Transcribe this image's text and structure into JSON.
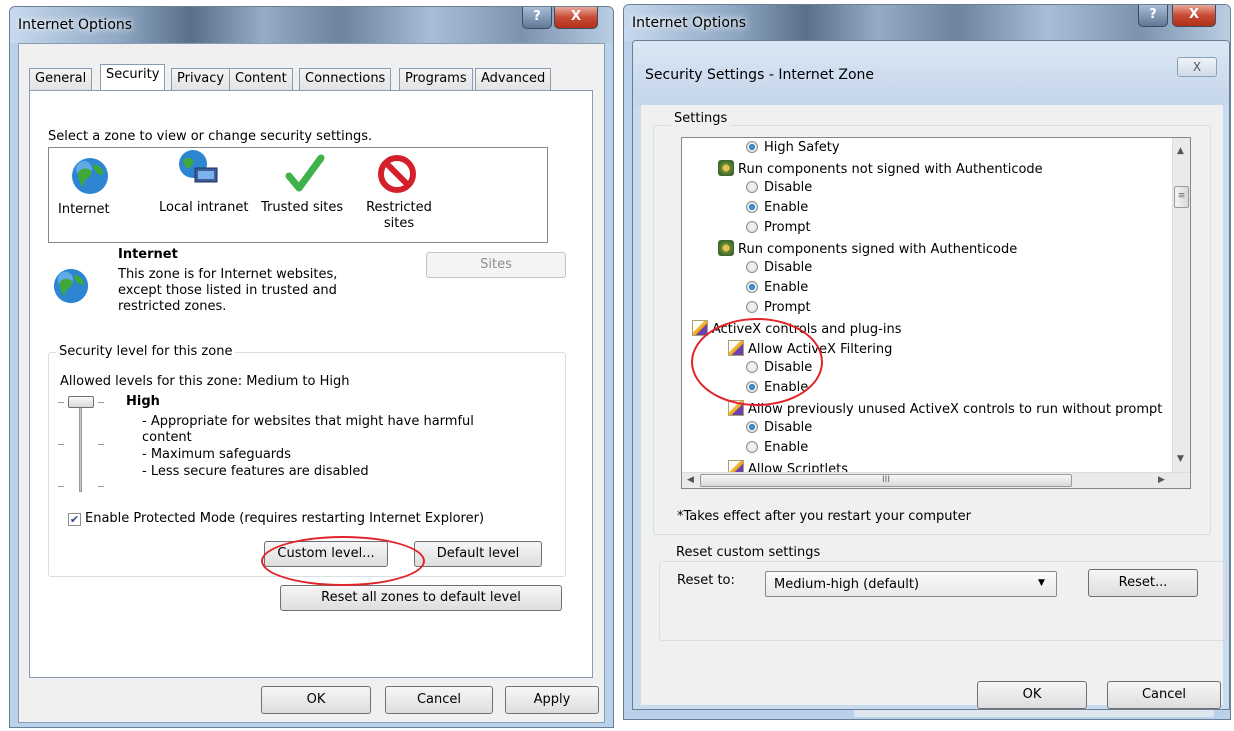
{
  "left": {
    "title": "Internet Options",
    "help": "?",
    "close": "X",
    "tabs": [
      "General",
      "Security",
      "Privacy",
      "Content",
      "Connections",
      "Programs",
      "Advanced"
    ],
    "zone_prompt": "Select a zone to view or change security settings.",
    "zones": [
      "Internet",
      "Local intranet",
      "Trusted sites",
      "Restricted sites"
    ],
    "zone_name": "Internet",
    "zone_desc": [
      "This zone is for Internet websites,",
      "except those listed in trusted and",
      "restricted zones."
    ],
    "sites": "Sites",
    "level_group": "Security level for this zone",
    "allowed": "Allowed levels for this zone: Medium to High",
    "level": "High",
    "level_lines": [
      "- Appropriate for websites that might have harmful",
      "content",
      "- Maximum safeguards",
      "- Less secure features are disabled"
    ],
    "protected": "Enable Protected Mode (requires restarting Internet Explorer)",
    "custom": "Custom level...",
    "default": "Default level",
    "reset_all": "Reset all zones to default level",
    "ok": "OK",
    "cancel": "Cancel",
    "apply": "Apply"
  },
  "right": {
    "title": "Internet Options",
    "help": "?",
    "close": "X",
    "dialog_title": "Security Settings - Internet Zone",
    "dialog_close": "X",
    "settings_label": "Settings",
    "items": [
      {
        "kind": "radio",
        "on": true,
        "text": "High Safety"
      },
      {
        "kind": "head",
        "text": "Run components not signed with Authenticode"
      },
      {
        "kind": "radio",
        "on": false,
        "text": "Disable"
      },
      {
        "kind": "radio",
        "on": true,
        "text": "Enable"
      },
      {
        "kind": "radio",
        "on": false,
        "text": "Prompt"
      },
      {
        "kind": "head",
        "text": "Run components signed with Authenticode"
      },
      {
        "kind": "radio",
        "on": false,
        "text": "Disable"
      },
      {
        "kind": "radio",
        "on": true,
        "text": "Enable"
      },
      {
        "kind": "radio",
        "on": false,
        "text": "Prompt"
      },
      {
        "kind": "category",
        "text": "ActiveX controls and plug-ins"
      },
      {
        "kind": "head2",
        "text": "Allow ActiveX Filtering"
      },
      {
        "kind": "radio",
        "on": false,
        "text": "Disable"
      },
      {
        "kind": "radio",
        "on": true,
        "text": "Enable"
      },
      {
        "kind": "head2",
        "text": "Allow previously unused ActiveX controls to run without prompt"
      },
      {
        "kind": "radio",
        "on": true,
        "text": "Disable"
      },
      {
        "kind": "radio",
        "on": false,
        "text": "Enable"
      },
      {
        "kind": "head2",
        "text": "Allow Scriptlets"
      }
    ],
    "hscroll_grip": "III",
    "note": "*Takes effect after you restart your computer",
    "reset_group": "Reset custom settings",
    "reset_to": "Reset to:",
    "reset_value": "Medium-high (default)",
    "reset_btn": "Reset...",
    "ok": "OK",
    "cancel": "Cancel"
  }
}
